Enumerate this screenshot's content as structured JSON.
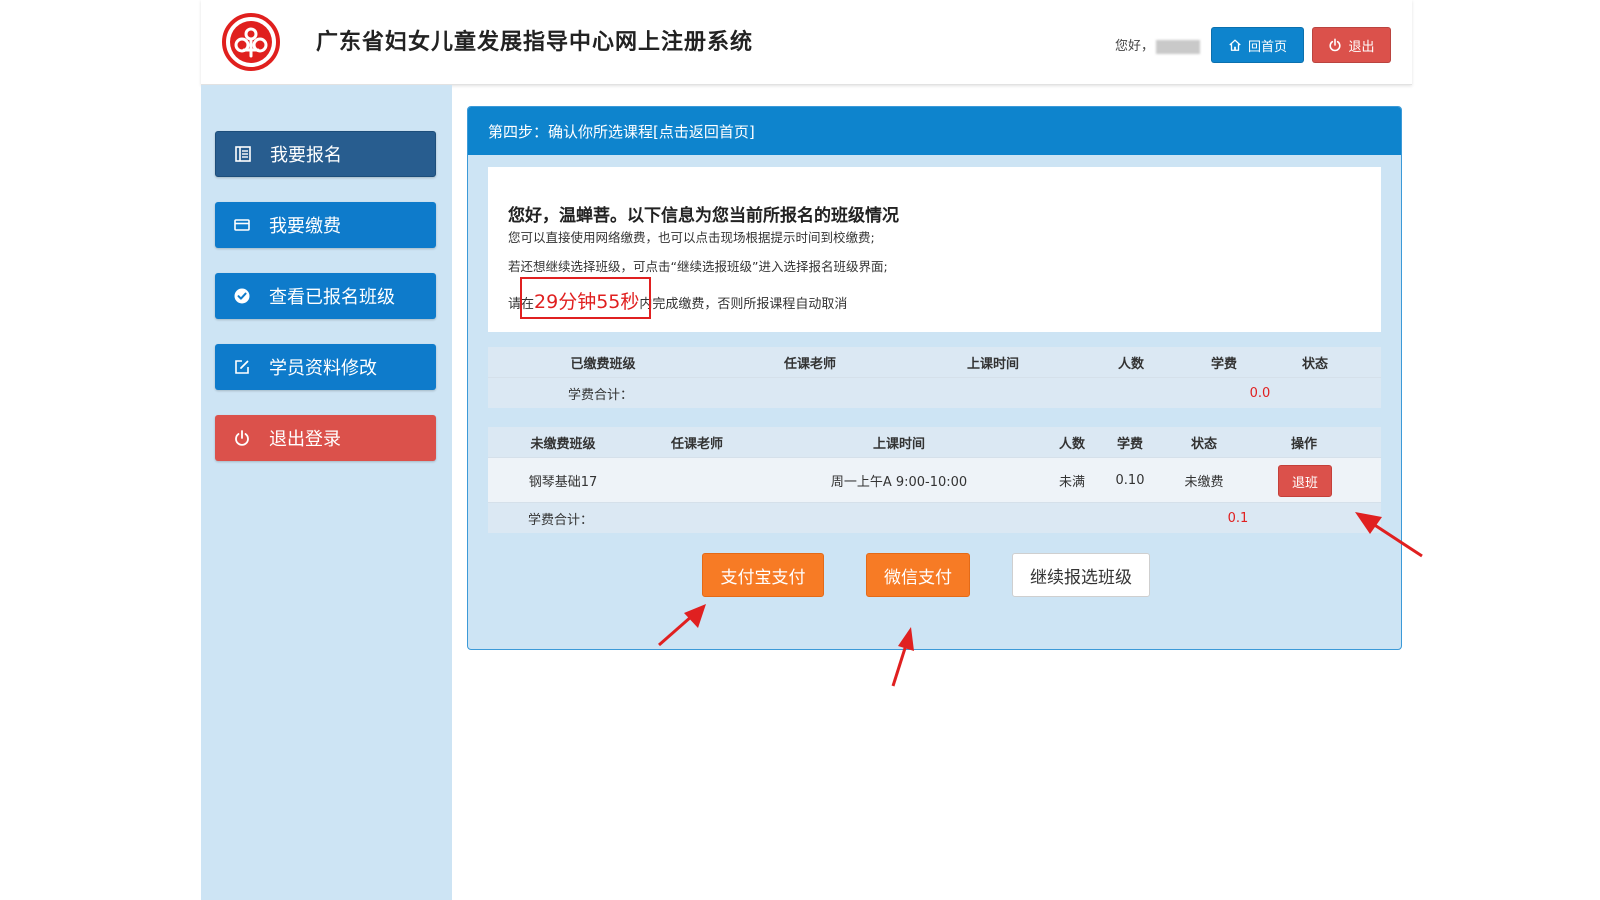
{
  "header": {
    "title": "广东省妇女儿童发展指导中心网上注册系统",
    "greeting": "您好，",
    "home_button": "回首页",
    "exit_button": "退出"
  },
  "sidebar": {
    "items": [
      {
        "label": "我要报名",
        "icon": "register-icon"
      },
      {
        "label": "我要缴费",
        "icon": "card-icon"
      },
      {
        "label": "查看已报名班级",
        "icon": "check-circle-icon"
      },
      {
        "label": "学员资料修改",
        "icon": "edit-icon"
      },
      {
        "label": "退出登录",
        "icon": "power-icon"
      }
    ]
  },
  "main": {
    "step_title": "第四步：确认你所选课程[点击返回首页]",
    "info": {
      "title": "您好，温蝉菩。以下信息为您当前所报名的班级情况",
      "line1": "您可以直接使用网络缴费，也可以点击现场根据提示时间到校缴费;",
      "line2": "若还想继续选择班级，可点击“继续选报班级”进入选择报名班级界面;",
      "countdown_prefix": "请在",
      "countdown": "29分钟55秒",
      "countdown_suffix": "内完成缴费，否则所报课程自动取消"
    },
    "paid_table": {
      "headers": [
        "已缴费班级",
        "任课老师",
        "上课时间",
        "人数",
        "学费",
        "状态"
      ],
      "sum_label": "学费合计：",
      "sum_value": "0.0"
    },
    "unpaid_table": {
      "headers": [
        "未缴费班级",
        "任课老师",
        "上课时间",
        "人数",
        "学费",
        "状态",
        "操作"
      ],
      "rows": [
        {
          "class_name": "钢琴基础17",
          "teacher": "",
          "time": "周一上午A 9:00-10:00",
          "count": "未满",
          "fee": "0.10",
          "status": "未缴费",
          "action": "退班"
        }
      ],
      "sum_label": "学费合计：",
      "sum_value": "0.1"
    },
    "buttons": {
      "alipay": "支付宝支付",
      "wechat": "微信支付",
      "continue": "继续报选班级"
    }
  },
  "colors": {
    "primary_blue": "#0e84cd",
    "danger_red": "#db514b",
    "orange": "#f77b25",
    "panel_bg": "#cde4f4"
  }
}
